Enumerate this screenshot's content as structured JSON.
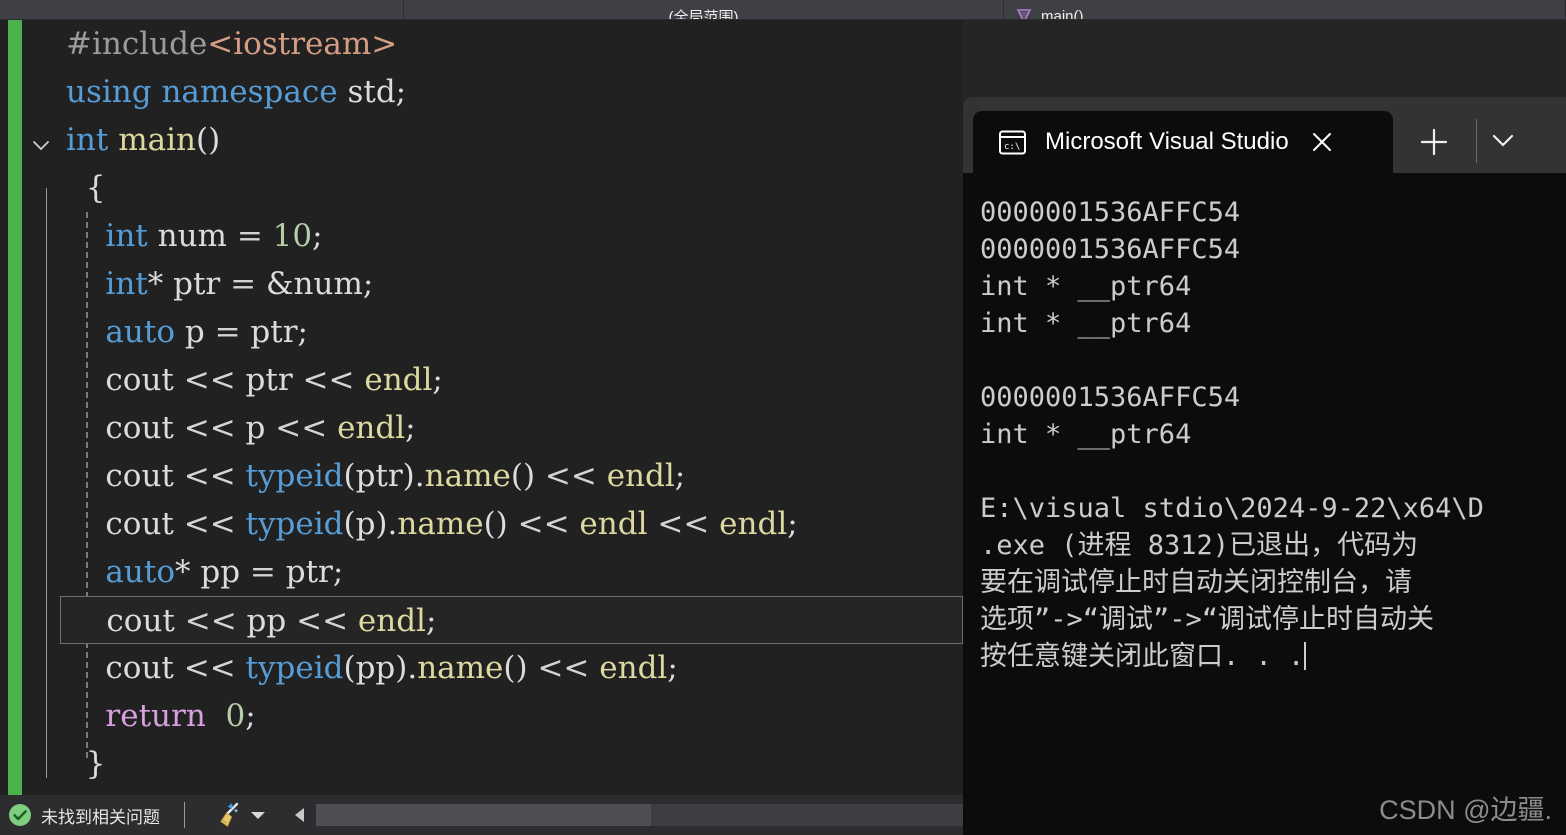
{
  "nav": {
    "scope_combo": "(全局范围)",
    "method_combo": "main()",
    "method_icon": "method-purple-icon"
  },
  "editor": {
    "change_bar_color": "#4bb14b",
    "background": "#212121",
    "current_line_index": 12,
    "lines": [
      {
        "indent": 0,
        "tokens": [
          {
            "t": "#include",
            "c": "t-pre"
          },
          {
            "t": "<iostream>",
            "c": "t-str"
          }
        ]
      },
      {
        "indent": 0,
        "tokens": [
          {
            "t": "using namespace",
            "c": "t-kw"
          },
          {
            "t": " std;",
            "c": "t-plain"
          }
        ]
      },
      {
        "indent": 0,
        "tokens": [
          {
            "t": "int",
            "c": "t-kw"
          },
          {
            "t": " ",
            "c": "t-plain"
          },
          {
            "t": "main",
            "c": "t-fn"
          },
          {
            "t": "()",
            "c": "t-brace"
          }
        ]
      },
      {
        "indent": 1,
        "tokens": [
          {
            "t": "{",
            "c": "t-brace"
          }
        ]
      },
      {
        "indent": 2,
        "tokens": [
          {
            "t": "int",
            "c": "t-kw"
          },
          {
            "t": " num ",
            "c": "t-plain"
          },
          {
            "t": "= ",
            "c": "t-op"
          },
          {
            "t": "10",
            "c": "t-num"
          },
          {
            "t": ";",
            "c": "t-plain"
          }
        ]
      },
      {
        "indent": 2,
        "tokens": [
          {
            "t": "int",
            "c": "t-kw"
          },
          {
            "t": "* ptr ",
            "c": "t-plain"
          },
          {
            "t": "= ",
            "c": "t-op"
          },
          {
            "t": "&num;",
            "c": "t-plain"
          }
        ]
      },
      {
        "indent": 2,
        "tokens": [
          {
            "t": "auto",
            "c": "t-kw"
          },
          {
            "t": " p ",
            "c": "t-plain"
          },
          {
            "t": "= ",
            "c": "t-op"
          },
          {
            "t": "ptr;",
            "c": "t-plain"
          }
        ]
      },
      {
        "indent": 2,
        "tokens": [
          {
            "t": "cout ",
            "c": "t-plain"
          },
          {
            "t": "<< ",
            "c": "t-op"
          },
          {
            "t": "ptr ",
            "c": "t-plain"
          },
          {
            "t": "<< ",
            "c": "t-op"
          },
          {
            "t": "endl",
            "c": "t-fn"
          },
          {
            "t": ";",
            "c": "t-plain"
          }
        ]
      },
      {
        "indent": 2,
        "tokens": [
          {
            "t": "cout ",
            "c": "t-plain"
          },
          {
            "t": "<< ",
            "c": "t-op"
          },
          {
            "t": "p ",
            "c": "t-plain"
          },
          {
            "t": "<< ",
            "c": "t-op"
          },
          {
            "t": "endl",
            "c": "t-fn"
          },
          {
            "t": ";",
            "c": "t-plain"
          }
        ]
      },
      {
        "indent": 2,
        "tokens": [
          {
            "t": "cout ",
            "c": "t-plain"
          },
          {
            "t": "<< ",
            "c": "t-op"
          },
          {
            "t": "typeid",
            "c": "t-kw"
          },
          {
            "t": "(ptr).",
            "c": "t-plain"
          },
          {
            "t": "name",
            "c": "t-fn"
          },
          {
            "t": "() ",
            "c": "t-plain"
          },
          {
            "t": "<< ",
            "c": "t-op"
          },
          {
            "t": "endl",
            "c": "t-fn"
          },
          {
            "t": ";",
            "c": "t-plain"
          }
        ]
      },
      {
        "indent": 2,
        "tokens": [
          {
            "t": "cout ",
            "c": "t-plain"
          },
          {
            "t": "<< ",
            "c": "t-op"
          },
          {
            "t": "typeid",
            "c": "t-kw"
          },
          {
            "t": "(p).",
            "c": "t-plain"
          },
          {
            "t": "name",
            "c": "t-fn"
          },
          {
            "t": "() ",
            "c": "t-plain"
          },
          {
            "t": "<< ",
            "c": "t-op"
          },
          {
            "t": "endl ",
            "c": "t-fn"
          },
          {
            "t": "<< ",
            "c": "t-op"
          },
          {
            "t": "endl",
            "c": "t-fn"
          },
          {
            "t": ";",
            "c": "t-plain"
          }
        ]
      },
      {
        "indent": 2,
        "tokens": [
          {
            "t": "auto",
            "c": "t-kw"
          },
          {
            "t": "* pp ",
            "c": "t-plain"
          },
          {
            "t": "= ",
            "c": "t-op"
          },
          {
            "t": "ptr;",
            "c": "t-plain"
          }
        ]
      },
      {
        "indent": 2,
        "tokens": [
          {
            "t": "cout ",
            "c": "t-plain"
          },
          {
            "t": "<< ",
            "c": "t-op"
          },
          {
            "t": "pp ",
            "c": "t-plain"
          },
          {
            "t": "<< ",
            "c": "t-op"
          },
          {
            "t": "endl",
            "c": "t-fn"
          },
          {
            "t": ";",
            "c": "t-plain"
          }
        ]
      },
      {
        "indent": 2,
        "tokens": [
          {
            "t": "cout ",
            "c": "t-plain"
          },
          {
            "t": "<< ",
            "c": "t-op"
          },
          {
            "t": "typeid",
            "c": "t-kw"
          },
          {
            "t": "(pp).",
            "c": "t-plain"
          },
          {
            "t": "name",
            "c": "t-fn"
          },
          {
            "t": "() ",
            "c": "t-plain"
          },
          {
            "t": "<< ",
            "c": "t-op"
          },
          {
            "t": "endl",
            "c": "t-fn"
          },
          {
            "t": ";",
            "c": "t-plain"
          }
        ]
      },
      {
        "indent": 2,
        "tokens": [
          {
            "t": "return",
            "c": "t-ret"
          },
          {
            "t": "  ",
            "c": "t-plain"
          },
          {
            "t": "0",
            "c": "t-num"
          },
          {
            "t": ";",
            "c": "t-plain"
          }
        ]
      },
      {
        "indent": 1,
        "tokens": [
          {
            "t": "}",
            "c": "t-brace"
          }
        ]
      }
    ]
  },
  "status": {
    "ok_icon": "check-circle-icon",
    "message": "未找到相关问题",
    "broom_icon": "broom-icon",
    "caret_icon": "chevron-down-icon",
    "scroll_left_icon": "scroll-left-arrow-icon"
  },
  "terminal": {
    "tab_icon": "console-cmd-icon",
    "tab_title": "Microsoft Visual Studio",
    "close_icon": "close-icon",
    "new_tab_icon": "plus-icon",
    "dropdown_icon": "chevron-down-icon",
    "background": "#0c0c0c",
    "output": [
      "0000001536AFFC54",
      "0000001536AFFC54",
      "int * __ptr64",
      "int * __ptr64",
      "",
      "0000001536AFFC54",
      "int * __ptr64",
      "",
      "E:\\visual stdio\\2024-9-22\\x64\\D",
      ".exe (进程 8312)已退出，代码为",
      "要在调试停止时自动关闭控制台，请",
      "选项”->“调试”->“调试停止时自动关",
      "按任意键关闭此窗口. . ."
    ]
  },
  "watermark": "CSDN @边疆."
}
